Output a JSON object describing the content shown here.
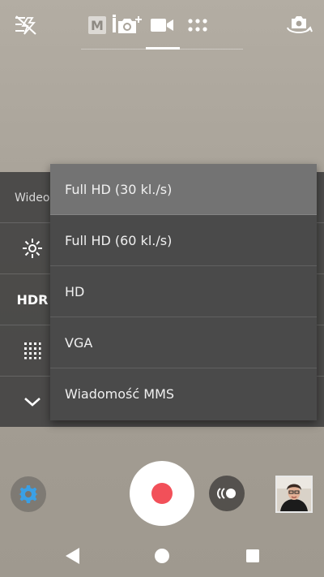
{
  "topbar": {
    "icons": [
      "flash-off-icon",
      "manual-mode-icon",
      "photo-mode-icon",
      "video-mode-icon",
      "more-modes-icon",
      "switch-camera-icon"
    ],
    "manual_mode_letter": "M",
    "active_mode": "video"
  },
  "side_panel": {
    "label": "Wideo",
    "icons": [
      "brightness-icon",
      "hdr-icon",
      "grid-icon",
      "chevron-down-icon"
    ],
    "hdr_label": "HDR"
  },
  "video_size_menu": {
    "options": [
      {
        "label": "Full HD (30 kl./s)",
        "selected": true
      },
      {
        "label": "Full HD (60 kl./s)",
        "selected": false
      },
      {
        "label": "HD",
        "selected": false
      },
      {
        "label": "VGA",
        "selected": false
      },
      {
        "label": "Wiadomość MMS",
        "selected": false
      }
    ]
  },
  "controls": {
    "icons": [
      "settings-icon",
      "record-icon",
      "burst-icon",
      "gallery-thumbnail"
    ]
  },
  "navbar": {
    "icons": [
      "back-icon",
      "home-icon",
      "recent-apps-icon"
    ]
  },
  "colors": {
    "record_red": "#f25059",
    "settings_blue": "#3aa0e6",
    "menu_bg": "#4a4a4a",
    "menu_selected": "#737373"
  }
}
